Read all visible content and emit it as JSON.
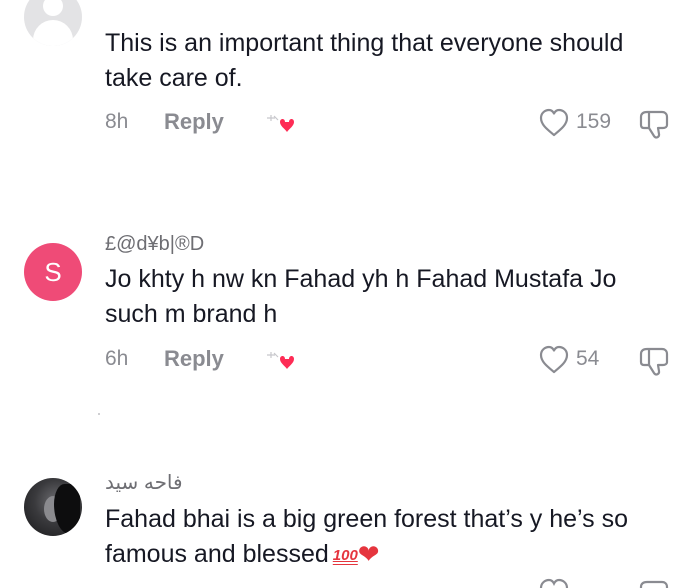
{
  "comments": [
    {
      "username": "",
      "avatar": "default-user-avatar",
      "text": "This is an important thing that everyone should take care of.",
      "time": "8h",
      "reply_label": "Reply",
      "likes": "159"
    },
    {
      "username": "£@d¥b|®D",
      "avatar": "S",
      "avatar_color": "#ef4b77",
      "text": "Jo khty h nw kn Fahad yh h Fahad Mustafa Jo such m brand h",
      "time": "6h",
      "reply_label": "Reply",
      "likes": "54"
    },
    {
      "username": "فاحه سيد",
      "avatar": "photo-avatar",
      "text": "Fahad bhai is a big green forest that’s y he’s so famous and blessed",
      "emoji_hundred": "100",
      "emoji_heart": "❤"
    }
  ],
  "colors": {
    "text": "#161823",
    "muted": "#8a8b91",
    "accent_red": "#fe2c55"
  }
}
